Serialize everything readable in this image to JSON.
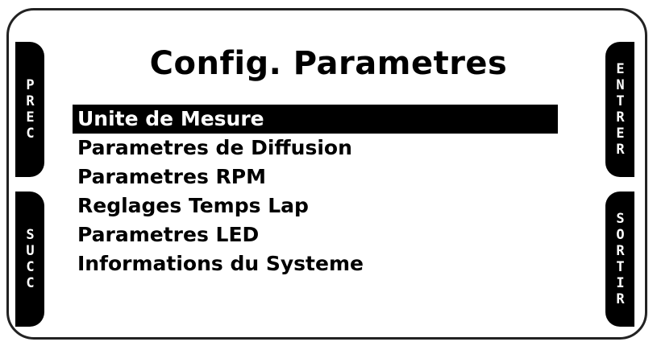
{
  "title": "Config. Parametres",
  "buttons": {
    "prec": "PREC",
    "succ": "SUCC",
    "entrer": "ENTRER",
    "sortir": "SORTIR"
  },
  "menu": {
    "selected_index": 0,
    "items": [
      {
        "label": "Unite de Mesure"
      },
      {
        "label": "Parametres de Diffusion"
      },
      {
        "label": "Parametres RPM"
      },
      {
        "label": "Reglages Temps Lap"
      },
      {
        "label": "Parametres LED"
      },
      {
        "label": "Informations du Systeme"
      }
    ]
  },
  "colors": {
    "background": "#ffffff",
    "foreground": "#000000",
    "highlight": "#000000"
  }
}
